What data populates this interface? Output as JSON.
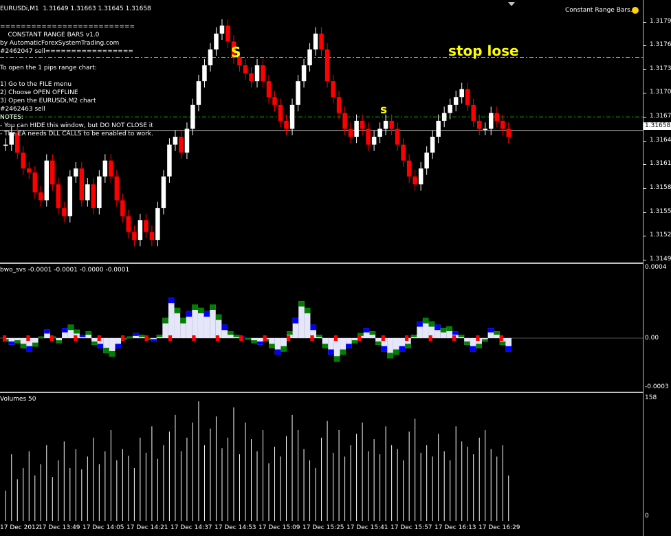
{
  "header": {
    "symbol_line": "EURUSDi,M1  1.31649 1.31663 1.31645 1.31658",
    "ea_name": "Constant Range Bars.x",
    "ea_icon": "smiley-icon"
  },
  "info_text": [
    "==========================",
    "    CONSTANT RANGE BARS v1.0",
    "by AutomaticForexSystemTrading.com",
    "#2462047 sell=================",
    "",
    "To open the 1 pips range chart:",
    "",
    "1) Go to the FILE menu",
    "2) Choose OPEN OFFLINE",
    "3) Open the EURUSDi,M2 chart",
    "#2462463 sell",
    "NOTES:",
    "- You can HIDE this window, but DO NOT CLOSE it",
    "- The EA needs DLL CALLS to be enabled to work."
  ],
  "annotations": {
    "stop_label": "stop lose",
    "s1": "S",
    "s2": "s"
  },
  "price_axis": [
    "1.31795",
    "1.31765",
    "1.31735",
    "1.31705",
    "1.31675",
    "1.31645",
    "1.31615",
    "1.31585",
    "1.31555",
    "1.31525",
    "1.31495"
  ],
  "current_price": "1.31658",
  "osc": {
    "title": "bwo_svs -0.0001 -0.0001 -0.0000 -0.0001",
    "ticks": [
      "0.0004",
      "0.00",
      "-0.0003"
    ]
  },
  "volume": {
    "title": "Volumes 50",
    "ticks": [
      "158",
      "0"
    ]
  },
  "time_axis": [
    "17 Dec 2012",
    "17 Dec 13:49",
    "17 Dec 14:05",
    "17 Dec 14:21",
    "17 Dec 14:37",
    "17 Dec 14:53",
    "17 Dec 15:09",
    "17 Dec 15:25",
    "17 Dec 15:41",
    "17 Dec 15:57",
    "17 Dec 16:13",
    "17 Dec 16:29"
  ],
  "colors": {
    "up": "#ffffff",
    "down": "#ff0000",
    "stop": "#ff9900",
    "entry": "#00aa00",
    "osc_main": "#e6e6fa",
    "osc_red": "#ff0000",
    "osc_blue": "#0000ff",
    "osc_green": "#008000"
  },
  "chart_data": {
    "type": "line",
    "title": "EURUSDi,M1",
    "ylabel": "",
    "ylim": [
      1.31495,
      1.31805
    ],
    "stop_level": 1.3175,
    "entry_level": 1.31675,
    "close": [
      1.3164,
      1.31655,
      1.3163,
      1.3161,
      1.31605,
      1.3158,
      1.3157,
      1.3162,
      1.3159,
      1.3156,
      1.3155,
      1.316,
      1.3161,
      1.3157,
      1.3159,
      1.3156,
      1.316,
      1.3162,
      1.316,
      1.3157,
      1.3155,
      1.3153,
      1.3152,
      1.31545,
      1.3153,
      1.3152,
      1.3156,
      1.316,
      1.3164,
      1.3165,
      1.3163,
      1.3166,
      1.3169,
      1.3172,
      1.3174,
      1.3176,
      1.3178,
      1.3179,
      1.3177,
      1.3175,
      1.3174,
      1.3173,
      1.3172,
      1.3174,
      1.3172,
      1.317,
      1.3169,
      1.3167,
      1.3166,
      1.3169,
      1.3172,
      1.3174,
      1.3176,
      1.3178,
      1.3176,
      1.3172,
      1.317,
      1.3168,
      1.3166,
      1.3165,
      1.3167,
      1.3166,
      1.3164,
      1.3165,
      1.3166,
      1.3167,
      1.3166,
      1.3164,
      1.3162,
      1.316,
      1.3159,
      1.3161,
      1.3163,
      1.3165,
      1.3167,
      1.3168,
      1.3169,
      1.317,
      1.3171,
      1.3169,
      1.3167,
      1.3166,
      1.3166,
      1.3168,
      1.3167,
      1.3166,
      1.3165
    ],
    "oscillator": [
      -2e-05,
      -4e-05,
      -3e-05,
      -6e-05,
      -8e-05,
      -5e-05,
      1e-05,
      5e-05,
      1e-05,
      -3e-05,
      6e-05,
      8e-05,
      5e-05,
      2e-05,
      4e-05,
      -4e-05,
      -6e-05,
      -9e-05,
      -0.00011,
      -6e-05,
      -1e-05,
      1e-05,
      3e-05,
      2e-05,
      -1e-05,
      -2e-05,
      2e-05,
      0.00012,
      0.00024,
      0.00018,
      0.00012,
      0.00016,
      0.0002,
      0.00018,
      0.00016,
      0.0002,
      0.00014,
      8e-05,
      4e-05,
      2e-05,
      1e-05,
      -1e-05,
      -3e-05,
      -4e-05,
      -2e-05,
      -6e-05,
      -0.0001,
      -8e-05,
      4e-05,
      0.00012,
      0.00022,
      0.00018,
      8e-05,
      2e-05,
      -6e-05,
      -0.0001,
      -0.00014,
      -0.0001,
      -6e-05,
      -3e-05,
      3e-05,
      6e-05,
      4e-05,
      -4e-05,
      -8e-05,
      -0.00012,
      -0.0001,
      -8e-05,
      -6e-05,
      2e-05,
      0.0001,
      0.00012,
      0.0001,
      8e-05,
      6e-05,
      7e-05,
      4e-05,
      2e-05,
      -4e-05,
      -8e-05,
      -6e-05,
      -2e-05,
      6e-05,
      4e-05,
      -4e-05,
      -8e-05
    ],
    "volume": [
      40,
      88,
      55,
      70,
      92,
      60,
      75,
      100,
      58,
      80,
      105,
      70,
      95,
      68,
      85,
      110,
      75,
      92,
      120,
      80,
      95,
      86,
      70,
      110,
      90,
      125,
      82,
      100,
      118,
      140,
      92,
      110,
      130,
      158,
      100,
      122,
      138,
      96,
      110,
      150,
      88,
      130,
      108,
      92,
      120,
      76,
      98,
      85,
      112,
      140,
      120,
      95,
      80,
      70,
      110,
      132,
      90,
      120,
      85,
      100,
      115,
      130,
      92,
      108,
      88,
      125,
      100,
      95,
      80,
      118,
      135,
      90,
      100,
      85,
      115,
      92,
      80,
      125,
      105,
      98,
      88,
      110,
      120,
      95,
      85,
      100,
      60
    ]
  }
}
